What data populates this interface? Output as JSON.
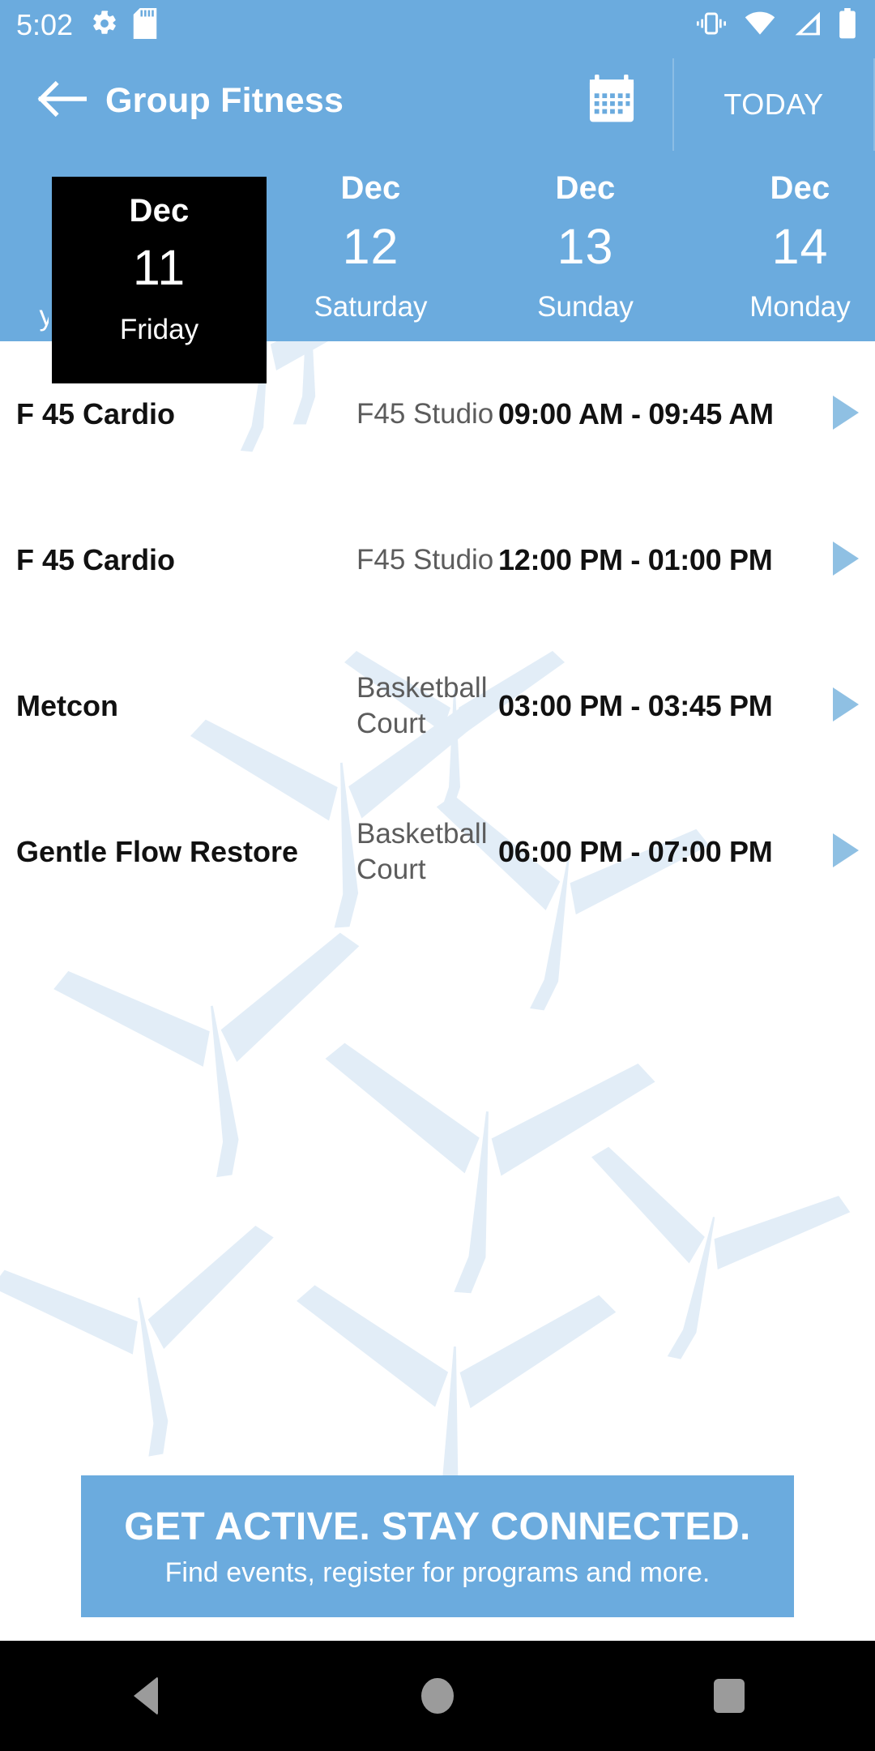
{
  "status_bar": {
    "clock": "5:02",
    "left_icons": [
      "gear-icon",
      "sd-card-icon"
    ],
    "right_icons": [
      "vibrate-icon",
      "wifi-icon",
      "cell-signal-icon",
      "battery-icon"
    ]
  },
  "app_bar": {
    "back_icon": "back-arrow-icon",
    "title": "Group Fitness",
    "calendar_icon": "calendar-icon",
    "today_label": "TODAY"
  },
  "day_strip": {
    "days": [
      {
        "month": "",
        "day": "",
        "weekday": "y",
        "partial": true,
        "selected": false
      },
      {
        "month": "Dec",
        "day": "11",
        "weekday": "Friday",
        "partial": false,
        "selected": true
      },
      {
        "month": "Dec",
        "day": "12",
        "weekday": "Saturday",
        "partial": false,
        "selected": false
      },
      {
        "month": "Dec",
        "day": "13",
        "weekday": "Sunday",
        "partial": false,
        "selected": false
      },
      {
        "month": "Dec",
        "day": "14",
        "weekday": "Monday",
        "partial": false,
        "selected": false
      }
    ],
    "selected": {
      "month": "Dec",
      "day": "11",
      "weekday": "Friday"
    }
  },
  "classes": [
    {
      "name": "F 45 Cardio",
      "location": "F45 Studio",
      "time": "09:00 AM - 09:45 AM",
      "arrow_icon": "play-arrow-icon"
    },
    {
      "name": "F 45 Cardio",
      "location": "F45 Studio",
      "time": "12:00 PM - 01:00 PM",
      "arrow_icon": "play-arrow-icon"
    },
    {
      "name": "Metcon",
      "location": "Basketball Court",
      "time": "03:00 PM - 03:45 PM",
      "arrow_icon": "play-arrow-icon"
    },
    {
      "name": "Gentle Flow Restore",
      "location": "Basketball Court",
      "time": "06:00 PM - 07:00 PM",
      "arrow_icon": "play-arrow-icon"
    }
  ],
  "promo": {
    "title": "GET ACTIVE.  STAY CONNECTED.",
    "subtitle": "Find events, register for programs and more."
  },
  "nav_bar": {
    "back": "nav-back-icon",
    "home": "nav-home-icon",
    "recents": "nav-recents-icon"
  },
  "colors": {
    "brand_blue": "#6BABDE",
    "selected_tile": "#000000",
    "arrow_blue": "#8FC0E3",
    "watermark_blue": "#E2EDF7",
    "text_dark": "#111111",
    "text_muted": "#5C5C5C"
  }
}
